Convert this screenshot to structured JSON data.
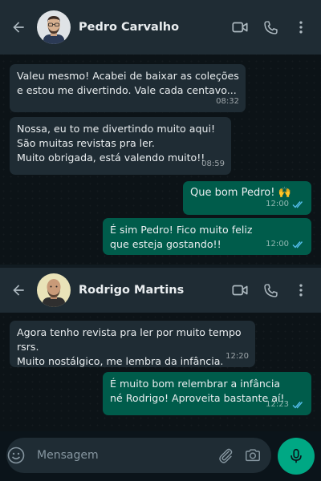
{
  "chat1": {
    "contact_name": "Pedro Carvalho",
    "messages": [
      {
        "direction": "in",
        "text": "Valeu mesmo! Acabei de baixar as coleções\ne estou me divertindo. Vale cada centavo...",
        "time": "08:32"
      },
      {
        "direction": "in",
        "text": "Nossa, eu to me divertindo muito aqui!\nSão muitas revistas pra ler.\nMuito obrigada, está valendo muito!!",
        "time": "08:59"
      },
      {
        "direction": "out",
        "text": "Que bom Pedro! 🙌",
        "time": "12:00"
      },
      {
        "direction": "out",
        "text": "É sim Pedro! Fico muito feliz\nque esteja gostando!!",
        "time": "12:00"
      }
    ]
  },
  "chat2": {
    "contact_name": "Rodrigo Martins",
    "messages": [
      {
        "direction": "in",
        "text": "Agora tenho revista pra ler por muito tempo rsrs.\nMuito nostálgico, me lembra da infância.",
        "time": "12:20"
      },
      {
        "direction": "out",
        "text": "É muito bom relembrar a infância\nné Rodrigo! Aproveita bastante aí!",
        "time": "12:23"
      }
    ]
  },
  "composer": {
    "placeholder": "Mensagem"
  },
  "icons": {
    "back": "arrow-left-icon",
    "video": "video-camera-icon",
    "call": "phone-icon",
    "menu": "more-vertical-icon",
    "emoji": "emoji-icon",
    "attach": "paperclip-icon",
    "camera": "camera-icon",
    "mic": "microphone-icon",
    "read": "double-check-icon"
  },
  "colors": {
    "header": "#1f2c34",
    "incoming_bubble": "#1f2c34",
    "outgoing_bubble": "#005c4b",
    "accent": "#00a884",
    "read_ticks": "#53bdeb"
  }
}
